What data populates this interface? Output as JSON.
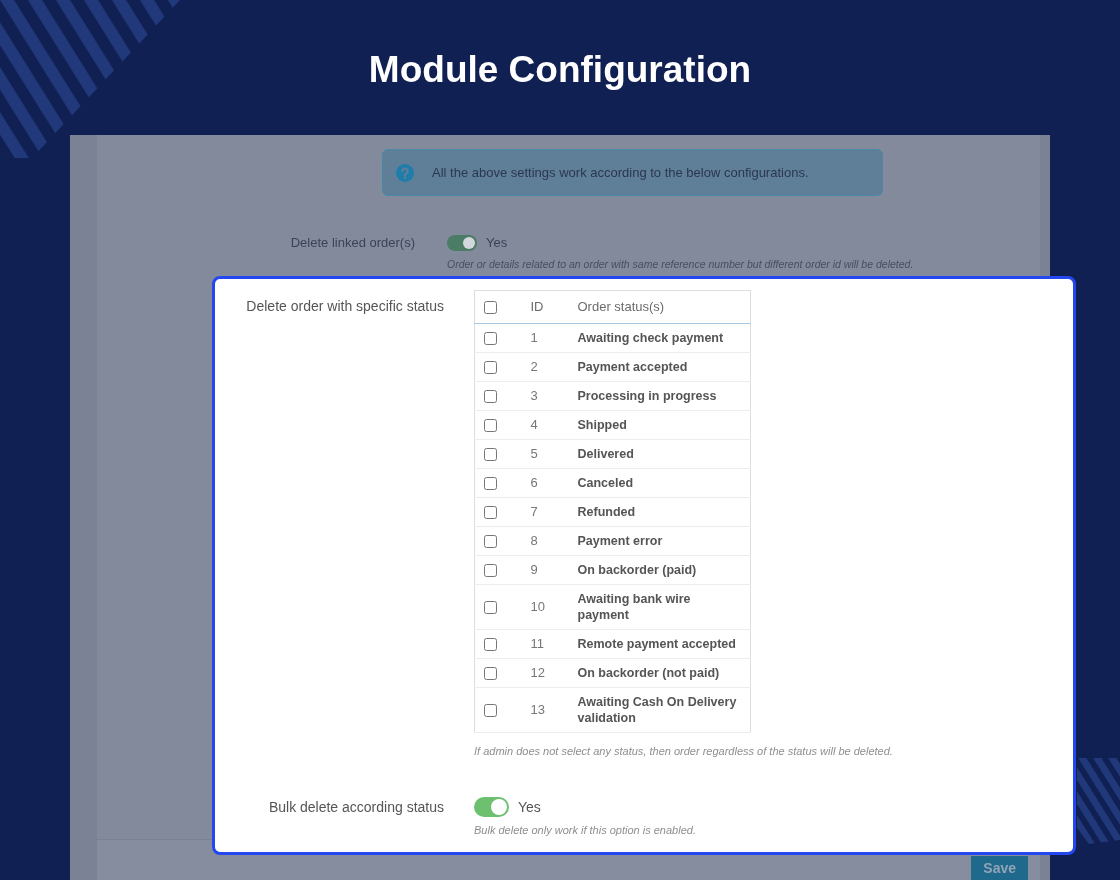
{
  "page": {
    "title": "Module Configuration"
  },
  "info_alert": {
    "text": "All the above settings work according to the below configurations."
  },
  "settings": [
    {
      "kind": "switch",
      "label": "Delete linked order(s)",
      "highlighted": false,
      "on": true,
      "value_label": "Yes",
      "hint": "Order or details related to an order with same reference number but different order id will be deleted."
    },
    {
      "kind": "status_table",
      "label": "Delete order with specific status",
      "highlighted": true,
      "table": {
        "select_all_checked": false,
        "columns": [
          "ID",
          "Order status(s)"
        ],
        "rows": [
          {
            "id": "1",
            "status": "Awaiting check payment",
            "checked": false
          },
          {
            "id": "2",
            "status": "Payment accepted",
            "checked": false
          },
          {
            "id": "3",
            "status": "Processing in progress",
            "checked": false
          },
          {
            "id": "4",
            "status": "Shipped",
            "checked": false
          },
          {
            "id": "5",
            "status": "Delivered",
            "checked": false
          },
          {
            "id": "6",
            "status": "Canceled",
            "checked": false
          },
          {
            "id": "7",
            "status": "Refunded",
            "checked": false
          },
          {
            "id": "8",
            "status": "Payment error",
            "checked": false
          },
          {
            "id": "9",
            "status": "On backorder (paid)",
            "checked": false
          },
          {
            "id": "10",
            "status": "Awaiting bank wire payment",
            "checked": false
          },
          {
            "id": "11",
            "status": "Remote payment accepted",
            "checked": false
          },
          {
            "id": "12",
            "status": "On backorder (not paid)",
            "checked": false
          },
          {
            "id": "13",
            "status": "Awaiting Cash On Delivery validation",
            "checked": false
          }
        ]
      },
      "hint": "If admin does not select any status, then order regardless of the status will be deleted."
    },
    {
      "kind": "switch",
      "label": "Bulk delete according status",
      "highlighted": true,
      "on": true,
      "value_label": "Yes",
      "hint": "Bulk delete only work if this option is enabled."
    }
  ],
  "footer": {
    "save_button": "Save"
  }
}
